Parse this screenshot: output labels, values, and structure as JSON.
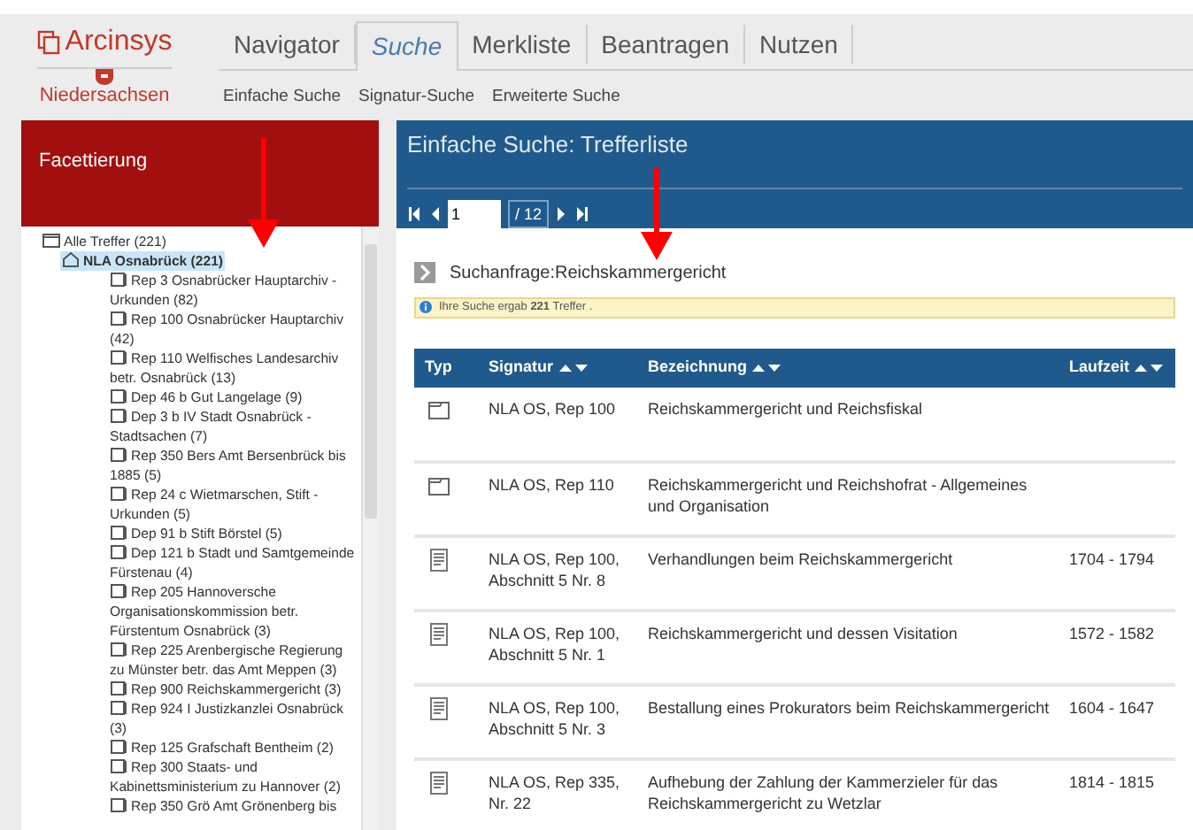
{
  "logo": {
    "name": "Arcinsys",
    "region": "Niedersachsen"
  },
  "nav": [
    {
      "label": "Navigator",
      "selected": false
    },
    {
      "label": "Suche",
      "selected": true
    },
    {
      "label": "Merkliste",
      "selected": false
    },
    {
      "label": "Beantragen",
      "selected": false
    },
    {
      "label": "Nutzen",
      "selected": false
    }
  ],
  "subnav": [
    "Einfache Suche",
    "Signatur-Suche",
    "Erweiterte Suche"
  ],
  "facets": {
    "title": "Facettierung",
    "tree": [
      {
        "kind": "root",
        "label": "Alle Treffer (221)",
        "selected": false,
        "children": [
          {
            "kind": "archive",
            "label": "NLA Osnabrück (221)",
            "selected": true,
            "children": [
              {
                "kind": "holding",
                "label": "Rep 3 Osnabrücker Hauptarchiv - Urkunden (82)",
                "selected": false
              },
              {
                "kind": "holding",
                "label": "Rep 100 Osnabrücker Hauptarchiv (42)",
                "selected": false
              },
              {
                "kind": "holding",
                "label": "Rep 110 Welfisches Landesarchiv betr. Osnabrück (13)",
                "selected": false
              },
              {
                "kind": "holding",
                "label": "Dep 46 b Gut Langelage (9)",
                "selected": false
              },
              {
                "kind": "holding",
                "label": "Dep 3 b IV Stadt Osnabrück - Stadtsachen (7)",
                "selected": false
              },
              {
                "kind": "holding",
                "label": "Rep 350 Bers Amt Bersenbrück bis 1885 (5)",
                "selected": false
              },
              {
                "kind": "holding",
                "label": "Rep 24 c Wietmarschen, Stift - Urkunden (5)",
                "selected": false
              },
              {
                "kind": "holding",
                "label": "Dep 91 b Stift Börstel (5)",
                "selected": false
              },
              {
                "kind": "holding",
                "label": "Dep 121 b Stadt und Samtgemeinde Fürstenau (4)",
                "selected": false
              },
              {
                "kind": "holding",
                "label": "Rep 205 Hannoversche Organisationskommission betr. Fürstentum Osnabrück (3)",
                "selected": false
              },
              {
                "kind": "holding",
                "label": "Rep 225 Arenbergische Regierung zu Münster betr. das Amt Meppen (3)",
                "selected": false
              },
              {
                "kind": "holding",
                "label": "Rep 900 Reichskammergericht (3)",
                "selected": false
              },
              {
                "kind": "holding",
                "label": "Rep 924 I Justizkanzlei Osnabrück (3)",
                "selected": false
              },
              {
                "kind": "holding",
                "label": "Rep 125 Grafschaft Bentheim (2)",
                "selected": false
              },
              {
                "kind": "holding",
                "label": "Rep 300 Staats- und Kabinettsministerium zu Hannover (2)",
                "selected": false
              },
              {
                "kind": "holding",
                "label": "Rep 350 Grö Amt Grönenberg bis",
                "selected": false
              }
            ]
          }
        ]
      }
    ]
  },
  "results": {
    "title": "Einfache Suche: Trefferliste",
    "page": "1",
    "pages": "/ 12",
    "query": "Suchanfrage:Reichskammergericht",
    "info": "Ihre Suche ergab **221** Treffer .",
    "columns": [
      "Typ",
      "Signatur",
      "Bezeichnung",
      "Laufzeit"
    ],
    "rows": [
      {
        "kind": "folder",
        "signatur": "NLA OS, Rep 100",
        "bezeichnung": "Reichskammergericht und Reichsfiskal"
      },
      {
        "kind": "folder",
        "signatur": "NLA OS, Rep 110",
        "bezeichnung": "Reichskammergericht und Reichshofrat - Allgemeines und Organisation"
      },
      {
        "kind": "document",
        "signatur": "NLA OS, Rep 100, Abschnitt 5 Nr. 8",
        "bezeichnung": "Verhandlungen beim Reichskammergericht",
        "laufzeit": "1704 - 1794"
      },
      {
        "kind": "document",
        "signatur": "NLA OS, Rep 100, Abschnitt 5 Nr. 1",
        "bezeichnung": "Reichskammergericht und dessen Visitation",
        "laufzeit": "1572 - 1582"
      },
      {
        "kind": "document",
        "signatur": "NLA OS, Rep 100, Abschnitt 5 Nr. 3",
        "bezeichnung": "Bestallung eines Prokurators beim Reichskammergericht",
        "laufzeit": "1604 - 1647"
      },
      {
        "kind": "document",
        "signatur": "NLA OS, Rep 335, Nr. 22",
        "bezeichnung": "Aufhebung der Zahlung der Kammerzieler für das Reichskammergericht zu Wetzlar",
        "laufzeit": "1814 - 1815"
      }
    ]
  }
}
